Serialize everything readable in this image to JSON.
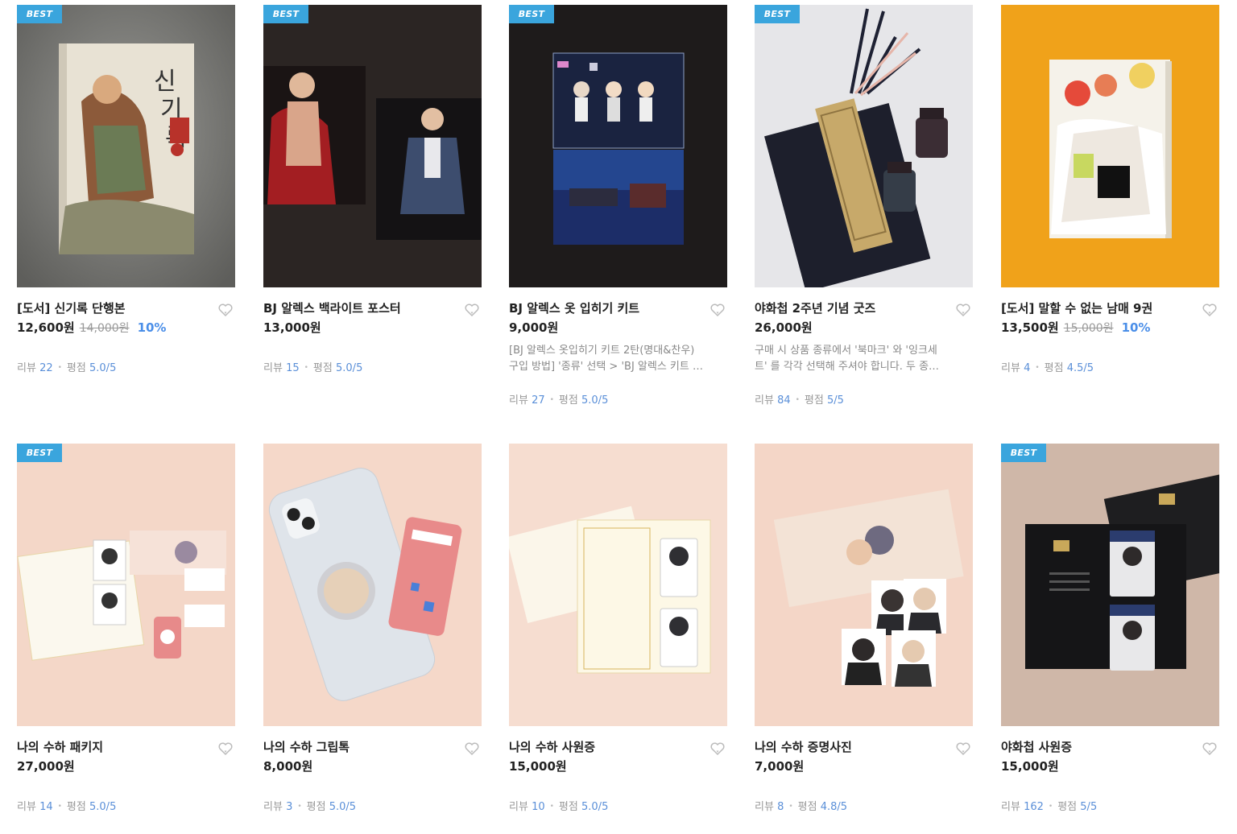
{
  "badge_label": "BEST",
  "review_label": "리뷰",
  "rating_label": "평점",
  "products": [
    {
      "title": "[도서] 신기록 단행본",
      "price": "12,600원",
      "original_price": "14,000원",
      "discount": "10%",
      "reviews": "22",
      "rating": "5.0",
      "rating_max": "5",
      "best": true
    },
    {
      "title": "BJ 알렉스 백라이트 포스터",
      "price": "13,000원",
      "reviews": "15",
      "rating": "5.0",
      "rating_max": "5",
      "best": true
    },
    {
      "title": "BJ 알렉스 옷 입히기 키트",
      "price": "9,000원",
      "desc_line1": "[BJ 알렉스 옷입히기 키트 2탄(명대&찬우)",
      "desc_line2": "구입 방법] '종류' 선택 > 'BJ 알렉스 키트 …",
      "reviews": "27",
      "rating": "5.0",
      "rating_max": "5",
      "best": true
    },
    {
      "title": "야화첩 2주년 기념 굿즈",
      "price": "26,000원",
      "desc_line1": "구매 시 상품 종류에서 '북마크' 와 '잉크세",
      "desc_line2": "트' 를 각각 선택해 주셔야 합니다. 두 종…",
      "reviews": "84",
      "rating": "5",
      "rating_max": "5",
      "best": true
    },
    {
      "title": "[도서] 말할 수 없는 남매 9권",
      "price": "13,500원",
      "original_price": "15,000원",
      "discount": "10%",
      "reviews": "4",
      "rating": "4.5",
      "rating_max": "5",
      "best": false
    },
    {
      "title": "나의 수하 패키지",
      "price": "27,000원",
      "reviews": "14",
      "rating": "5.0",
      "rating_max": "5",
      "best": true
    },
    {
      "title": "나의 수하 그립톡",
      "price": "8,000원",
      "reviews": "3",
      "rating": "5.0",
      "rating_max": "5",
      "best": false
    },
    {
      "title": "나의 수하 사원증",
      "price": "15,000원",
      "reviews": "10",
      "rating": "5.0",
      "rating_max": "5",
      "best": false
    },
    {
      "title": "나의 수하 증명사진",
      "price": "7,000원",
      "reviews": "8",
      "rating": "4.8",
      "rating_max": "5",
      "best": false
    },
    {
      "title": "야화첩 사원증",
      "price": "15,000원",
      "reviews": "162",
      "rating": "5",
      "rating_max": "5",
      "best": true
    }
  ]
}
